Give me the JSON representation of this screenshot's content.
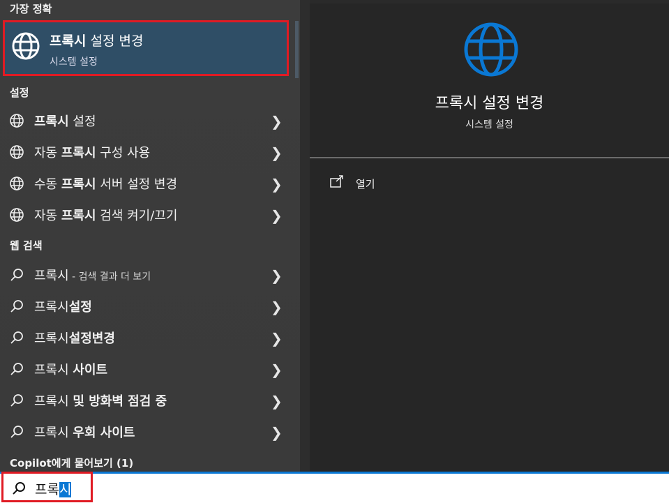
{
  "sections": {
    "best_match": "가장 정확",
    "settings": "설정",
    "web_search": "웹 검색",
    "copilot": "Copilot에게 물어보기 (1)"
  },
  "best_match": {
    "title_bold": "프록시",
    "title_rest": " 설정 변경",
    "subtitle": "시스템 설정",
    "icon": "globe-icon"
  },
  "settings_items": [
    {
      "pre": "",
      "bold": "프록시",
      "post": " 설정"
    },
    {
      "pre": "자동 ",
      "bold": "프록시",
      "post": " 구성 사용"
    },
    {
      "pre": "수동 ",
      "bold": "프록시",
      "post": " 서버 설정 변경"
    },
    {
      "pre": "자동 ",
      "bold": "프록시",
      "post": " 검색 켜기/끄기"
    }
  ],
  "web_items": [
    {
      "pre": "프록시",
      "bold": "",
      "small": " - 검색 결과 더 보기"
    },
    {
      "pre": "프록시",
      "bold": "설정",
      "small": ""
    },
    {
      "pre": "프록시",
      "bold": "설정변경",
      "small": ""
    },
    {
      "pre": "프록시 ",
      "bold": "사이트",
      "small": ""
    },
    {
      "pre": "프록시 ",
      "bold": "및 방화벽 점검 중",
      "small": ""
    },
    {
      "pre": "프록시 ",
      "bold": "우회 사이트",
      "small": ""
    }
  ],
  "preview": {
    "title": "프록시 설정 변경",
    "subtitle": "시스템 설정",
    "open_label": "열기"
  },
  "search": {
    "text_plain": "프록",
    "text_selected": "시"
  },
  "colors": {
    "accent": "#0a78d4",
    "highlight": "#e01b24",
    "selected_bg": "#2f4e66"
  }
}
